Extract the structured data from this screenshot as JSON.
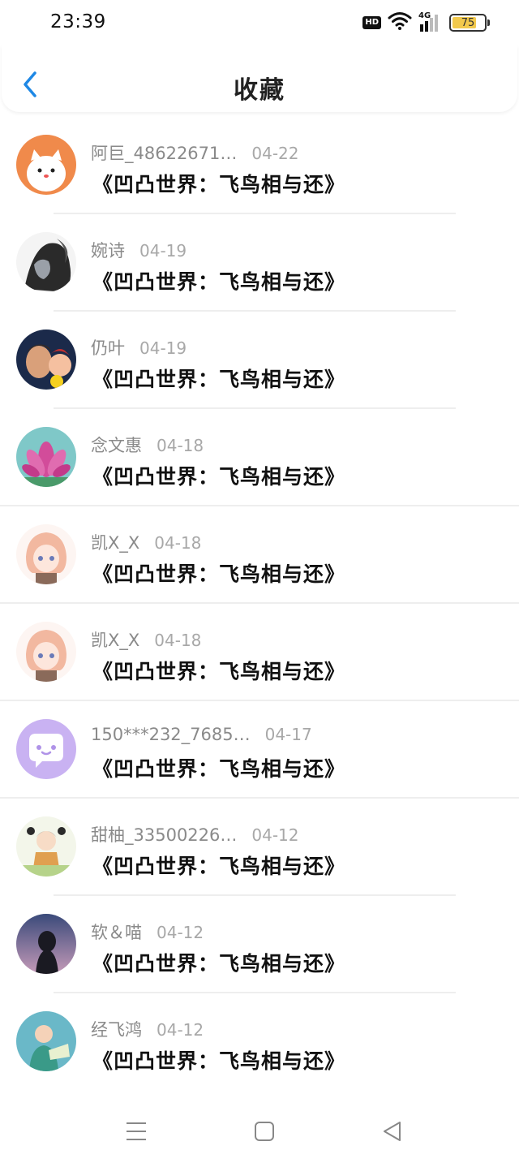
{
  "status_bar": {
    "time": "23:39",
    "hd_label": "HD",
    "network_label": "4G",
    "battery_level": "75",
    "battery_fraction": 0.75,
    "battery_color": "#f2c94c"
  },
  "header": {
    "back_icon": "chevron-left-icon",
    "title": "收藏",
    "accent_color": "#1e88e5"
  },
  "items": [
    {
      "username": "阿巨_48622671…",
      "date": "04-22",
      "title": "《凹凸世界：飞鸟相与还》"
    },
    {
      "username": "婉诗",
      "date": "04-19",
      "title": "《凹凸世界：飞鸟相与还》"
    },
    {
      "username": "仍叶",
      "date": "04-19",
      "title": "《凹凸世界：飞鸟相与还》"
    },
    {
      "username": "念文惠",
      "date": "04-18",
      "title": "《凹凸世界：飞鸟相与还》"
    },
    {
      "username": "凯X_X",
      "date": "04-18",
      "title": "《凹凸世界：飞鸟相与还》"
    },
    {
      "username": "凯X_X",
      "date": "04-18",
      "title": "《凹凸世界：飞鸟相与还》"
    },
    {
      "username": "150***232_7685…",
      "date": "04-17",
      "title": "《凹凸世界：飞鸟相与还》"
    },
    {
      "username": "甜柚_33500226…",
      "date": "04-12",
      "title": "《凹凸世界：飞鸟相与还》"
    },
    {
      "username": "软＆喵",
      "date": "04-12",
      "title": "《凹凸世界：飞鸟相与还》"
    },
    {
      "username": "经飞鸿",
      "date": "04-12",
      "title": "《凹凸世界：飞鸟相与还》"
    }
  ],
  "nav_bar": {
    "menu_icon": "menu-icon",
    "home_icon": "home-square-icon",
    "back_icon": "back-triangle-icon"
  }
}
